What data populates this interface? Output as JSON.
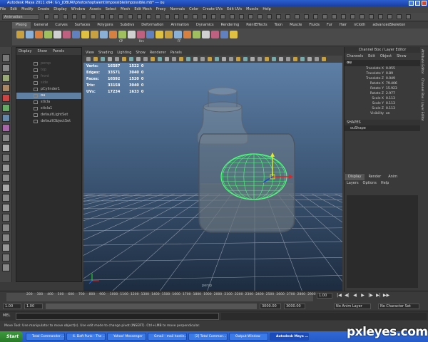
{
  "window": {
    "title": "Autodesk Maya 2011 x64: G:\\_JOBURI\\photoshoptalent\\impossible\\impossible.mb* --- ou"
  },
  "menubar": [
    "File",
    "Edit",
    "Modify",
    "Create",
    "Display",
    "Window",
    "Assets",
    "Select",
    "Mesh",
    "Edit Mesh",
    "Proxy",
    "Normals",
    "Color",
    "Create UVs",
    "Edit UVs",
    "Muscle",
    "Help"
  ],
  "status": {
    "mode": "Animation"
  },
  "shelf_tabs": [
    "Phong",
    "General",
    "Curves",
    "Surfaces",
    "Polygons",
    "Subdivs",
    "Deformation",
    "Animation",
    "Dynamics",
    "Rendering",
    "PaintEffects",
    "Toon",
    "Muscle",
    "Fluids",
    "Fur",
    "Hair",
    "nCloth",
    "advancedSkeleton"
  ],
  "shelf_labels": [
    "CP",
    "Hrs",
    "FF"
  ],
  "outliner": {
    "menu": [
      "Display",
      "Show",
      "Panels"
    ],
    "items": [
      {
        "label": "persp",
        "state": "dim"
      },
      {
        "label": "top",
        "state": "dim"
      },
      {
        "label": "front",
        "state": "dim"
      },
      {
        "label": "side",
        "state": "dim"
      },
      {
        "label": "pCylinder1",
        "state": "normal"
      },
      {
        "label": "ou",
        "state": "selected"
      },
      {
        "label": "sticla",
        "state": "normal"
      },
      {
        "label": "sticla1",
        "state": "normal"
      },
      {
        "label": "defaultLightSet",
        "state": "normal"
      },
      {
        "label": "defaultObjectSet",
        "state": "normal"
      }
    ]
  },
  "viewport": {
    "menu": [
      "View",
      "Shading",
      "Lighting",
      "Show",
      "Renderer",
      "Panels"
    ],
    "hud": [
      {
        "label": "Verts:",
        "a": "16587",
        "b": "1522",
        "c": "0"
      },
      {
        "label": "Edges:",
        "a": "33571",
        "b": "3040",
        "c": "0"
      },
      {
        "label": "Faces:",
        "a": "16592",
        "b": "1520",
        "c": "0"
      },
      {
        "label": "Tris:",
        "a": "33158",
        "b": "3040",
        "c": "0"
      },
      {
        "label": "UVs:",
        "a": "17234",
        "b": "1633",
        "c": "0"
      }
    ],
    "camera_label": "persp"
  },
  "channel_box": {
    "title": "Channel Box / Layer Editor",
    "menu": [
      "Channels",
      "Edit",
      "Object",
      "Show"
    ],
    "object": "ou",
    "attributes": [
      {
        "k": "Translate X",
        "v": "0.055"
      },
      {
        "k": "Translate Y",
        "v": "0.89"
      },
      {
        "k": "Translate Z",
        "v": "0.049"
      },
      {
        "k": "Rotate X",
        "v": "79.406"
      },
      {
        "k": "Rotate Y",
        "v": "15.923"
      },
      {
        "k": "Rotate Z",
        "v": "2.977"
      },
      {
        "k": "Scale X",
        "v": "0.113"
      },
      {
        "k": "Scale Y",
        "v": "0.113"
      },
      {
        "k": "Scale Z",
        "v": "0.113"
      },
      {
        "k": "Visibility",
        "v": "on"
      }
    ],
    "shapes_header": "SHAPES",
    "shape_name": "ouShape"
  },
  "layer_editor": {
    "tabs": [
      "Display",
      "Render",
      "Anim"
    ],
    "menu": [
      "Layers",
      "Options",
      "Help"
    ]
  },
  "side_tabs": [
    "Attribute Editor",
    "Channel Box / Layer Editor"
  ],
  "time_slider": {
    "ticks": [
      "200",
      "300",
      "400",
      "500",
      "600",
      "700",
      "800",
      "900",
      "1000",
      "1100",
      "1200",
      "1300",
      "1400",
      "1500",
      "1600",
      "1700",
      "1800",
      "1900",
      "2000",
      "2100",
      "2200",
      "2300",
      "2400",
      "2500",
      "2600",
      "2700",
      "2800",
      "2900"
    ],
    "current": "1.00",
    "playback": [
      "|◀",
      "◀|",
      "◀",
      "▶",
      "|▶",
      "▶|",
      "▶▶"
    ]
  },
  "range": {
    "start": "1.00",
    "start2": "1.00",
    "end": "3000.00",
    "end2": "3000.00",
    "anim_layer": "No Anim Layer",
    "char_set": "No Character Set"
  },
  "command_line": {
    "label": "MEL"
  },
  "help_line": "Move Tool: Use manipulator to move object(s). Use edit mode to change pivot (INSERT). Ctrl+LMB to move perpendicular.",
  "taskbar": {
    "start": "Start",
    "tasks": [
      {
        "label": "Total Commander ...",
        "active": false
      },
      {
        "label": "6. Daft Punk - The ...",
        "active": false
      },
      {
        "label": "Yahoo! Messenger",
        "active": false
      },
      {
        "label": "Gmail - mail hostin...",
        "active": false
      },
      {
        "label": "[2] Total Comman...",
        "active": false
      },
      {
        "label": "Output Window",
        "active": false
      },
      {
        "label": "Autodesk Maya ...",
        "active": true
      }
    ]
  },
  "watermark": "pxleyes.com",
  "colors": {
    "selection": "#5f7fa3",
    "mesh": "#4cff7a",
    "taskbar": "#245bc8"
  }
}
